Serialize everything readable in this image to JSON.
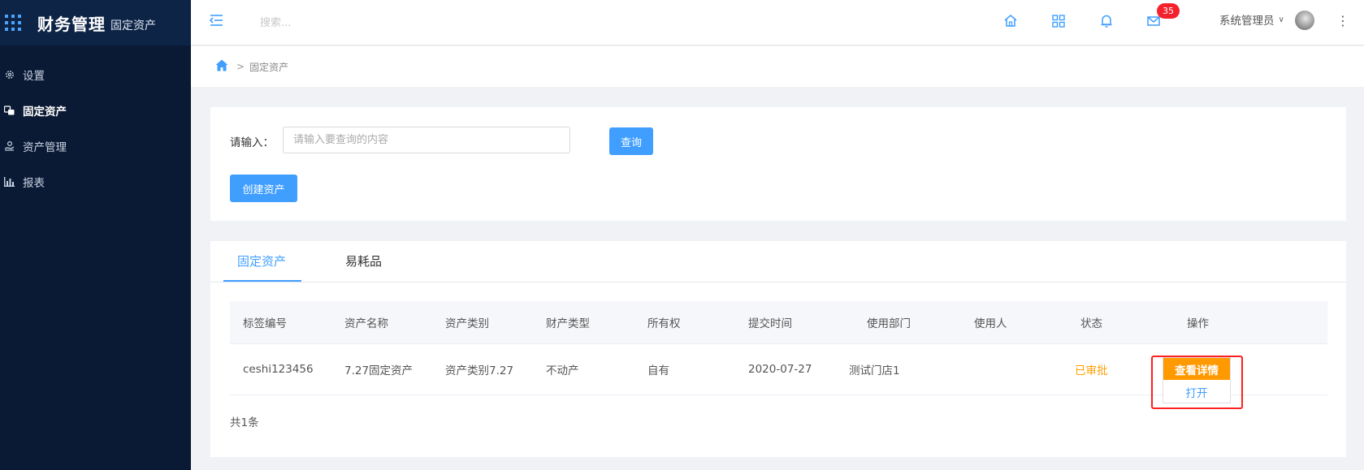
{
  "app": {
    "title": "财务管理",
    "subtitle": "固定资产"
  },
  "sidebar": {
    "items": [
      {
        "label": "设置",
        "icon": "gear-icon"
      },
      {
        "label": "固定资产",
        "icon": "assets-icon",
        "active": true
      },
      {
        "label": "资产管理",
        "icon": "hand-money-icon"
      },
      {
        "label": "报表",
        "icon": "bar-chart-icon"
      }
    ]
  },
  "header": {
    "search_placeholder": "搜索...",
    "mail_badge": "35",
    "user_name": "系统管理员",
    "user_chevron": "∨"
  },
  "breadcrumb": {
    "separator": ">",
    "current": "固定资产"
  },
  "search_form": {
    "label": "请输入：",
    "placeholder": "请输入要查询的内容",
    "query_button": "查询",
    "create_button": "创建资产"
  },
  "tabs": [
    {
      "label": "固定资产",
      "active": true
    },
    {
      "label": "易耗品",
      "active": false
    }
  ],
  "table": {
    "columns": [
      "标签编号",
      "资产名称",
      "资产类别",
      "财产类型",
      "所有权",
      "提交时间",
      "使用部门",
      "使用人",
      "状态",
      "操作"
    ],
    "rows": [
      {
        "tag_no": "ceshi123456",
        "name": "7.27固定资产",
        "category": "资产类别7.27",
        "property_type": "不动产",
        "ownership": "自有",
        "submit_time": "2020-07-27",
        "department": "测试门店1",
        "user": "",
        "status": "已审批",
        "action_detail": "查看详情",
        "action_open": "打开"
      }
    ],
    "total": "共1条"
  },
  "colors": {
    "sidebar_bg": "#0b1a34",
    "primary": "#409eff",
    "warning": "#ff9900",
    "badge": "#f5222d",
    "highlight": "#ff1f1f"
  }
}
